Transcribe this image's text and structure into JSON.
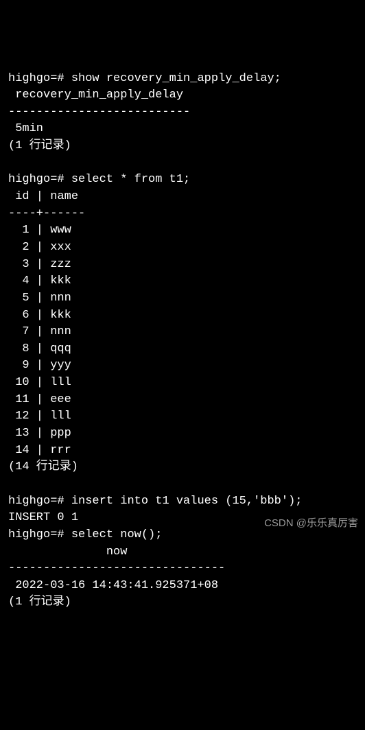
{
  "prompt": "highgo=#",
  "cmd1": {
    "command": "show recovery_min_apply_delay;",
    "header": " recovery_min_apply_delay",
    "separator": "--------------------------",
    "value": " 5min",
    "footer": "(1 行记录)"
  },
  "cmd2": {
    "command": "select * from t1;",
    "header": " id | name",
    "separator": "----+------",
    "rows": [
      {
        "id": "  1",
        "name": "www"
      },
      {
        "id": "  2",
        "name": "xxx"
      },
      {
        "id": "  3",
        "name": "zzz"
      },
      {
        "id": "  4",
        "name": "kkk"
      },
      {
        "id": "  5",
        "name": "nnn"
      },
      {
        "id": "  6",
        "name": "kkk"
      },
      {
        "id": "  7",
        "name": "nnn"
      },
      {
        "id": "  8",
        "name": "qqq"
      },
      {
        "id": "  9",
        "name": "yyy"
      },
      {
        "id": " 10",
        "name": "lll"
      },
      {
        "id": " 11",
        "name": "eee"
      },
      {
        "id": " 12",
        "name": "lll"
      },
      {
        "id": " 13",
        "name": "ppp"
      },
      {
        "id": " 14",
        "name": "rrr"
      }
    ],
    "footer": "(14 行记录)"
  },
  "cmd3": {
    "command": "insert into t1 values (15,'bbb');",
    "result": "INSERT 0 1"
  },
  "cmd4": {
    "command": "select now();",
    "header": "              now",
    "separator": "-------------------------------",
    "value": " 2022-03-16 14:43:41.925371+08",
    "footer": "(1 行记录)"
  },
  "watermark": "CSDN @乐乐真厉害"
}
